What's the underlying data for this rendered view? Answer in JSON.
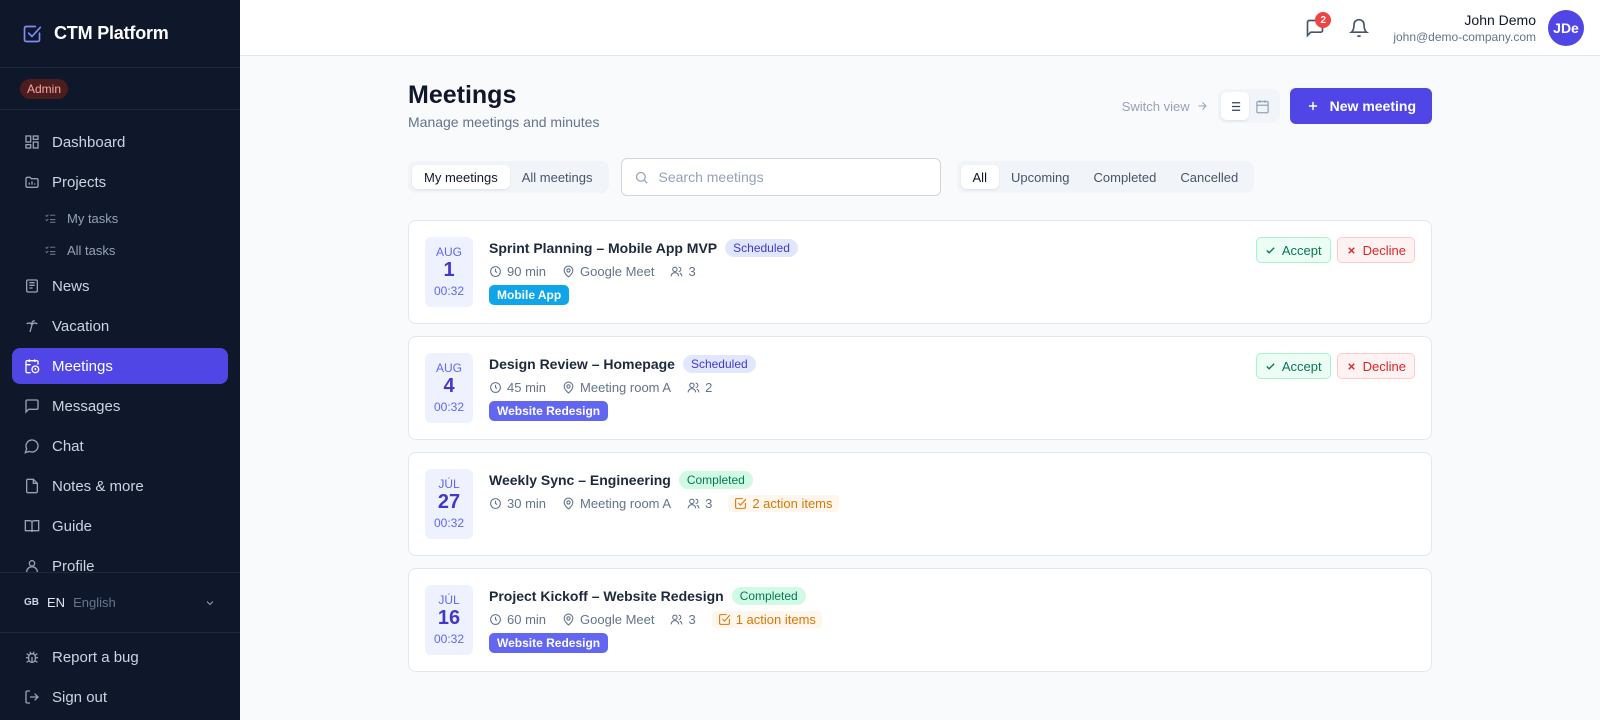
{
  "app": {
    "name": "CTM Platform",
    "role": "Admin"
  },
  "colors": {
    "sidebar_bg": "#0f172a",
    "accent": "#4f46e5",
    "admin_badge_bg": "#4c1d1d"
  },
  "sidebar": {
    "items": [
      {
        "label": "Dashboard",
        "icon": "dashboard-icon"
      },
      {
        "label": "Projects",
        "icon": "folder-icon"
      },
      {
        "label": "My tasks",
        "icon": "task-list-icon"
      },
      {
        "label": "All tasks",
        "icon": "task-list-icon"
      },
      {
        "label": "News",
        "icon": "newspaper-icon"
      },
      {
        "label": "Vacation",
        "icon": "palm-tree-icon"
      },
      {
        "label": "Meetings",
        "icon": "calendar-clock-icon",
        "active": true
      },
      {
        "label": "Messages",
        "icon": "message-square-icon"
      },
      {
        "label": "Chat",
        "icon": "chat-bubble-icon"
      },
      {
        "label": "Notes & more",
        "icon": "note-icon"
      },
      {
        "label": "Guide",
        "icon": "book-icon"
      },
      {
        "label": "Profile",
        "icon": "user-icon"
      }
    ],
    "language": {
      "flag": "GB",
      "code": "EN",
      "name": "English"
    },
    "report_bug": "Report a bug",
    "sign_out": "Sign out"
  },
  "header": {
    "messages_badge": "2",
    "user": {
      "name": "John Demo",
      "email": "john@demo-company.com",
      "initials": "JDe"
    }
  },
  "page": {
    "title": "Meetings",
    "subtitle": "Manage meetings and minutes",
    "switch_view": "Switch view",
    "new_meeting": "New meeting",
    "scope_tabs": [
      "My meetings",
      "All meetings"
    ],
    "search_placeholder": "Search meetings",
    "status_tabs": [
      "All",
      "Upcoming",
      "Completed",
      "Cancelled"
    ]
  },
  "meetings": [
    {
      "month": "AUG",
      "day": "1",
      "time": "00:32",
      "title": "Sprint Planning – Mobile App MVP",
      "status": "Scheduled",
      "duration": "90 min",
      "location": "Google Meet",
      "attendees": "3",
      "action_items": "",
      "tag": "Mobile App",
      "tag_color": "#0ea5e9",
      "accept": "Accept",
      "decline": "Decline"
    },
    {
      "month": "AUG",
      "day": "4",
      "time": "00:32",
      "title": "Design Review – Homepage",
      "status": "Scheduled",
      "duration": "45 min",
      "location": "Meeting room A",
      "attendees": "2",
      "action_items": "",
      "tag": "Website Redesign",
      "tag_color": "#6366f1",
      "accept": "Accept",
      "decline": "Decline"
    },
    {
      "month": "JÚL",
      "day": "27",
      "time": "00:32",
      "title": "Weekly Sync – Engineering",
      "status": "Completed",
      "duration": "30 min",
      "location": "Meeting room A",
      "attendees": "3",
      "action_items": "2 action items",
      "tag": "",
      "tag_color": ""
    },
    {
      "month": "JÚL",
      "day": "16",
      "time": "00:32",
      "title": "Project Kickoff – Website Redesign",
      "status": "Completed",
      "duration": "60 min",
      "location": "Google Meet",
      "attendees": "3",
      "action_items": "1 action items",
      "tag": "Website Redesign",
      "tag_color": "#6366f1"
    }
  ]
}
